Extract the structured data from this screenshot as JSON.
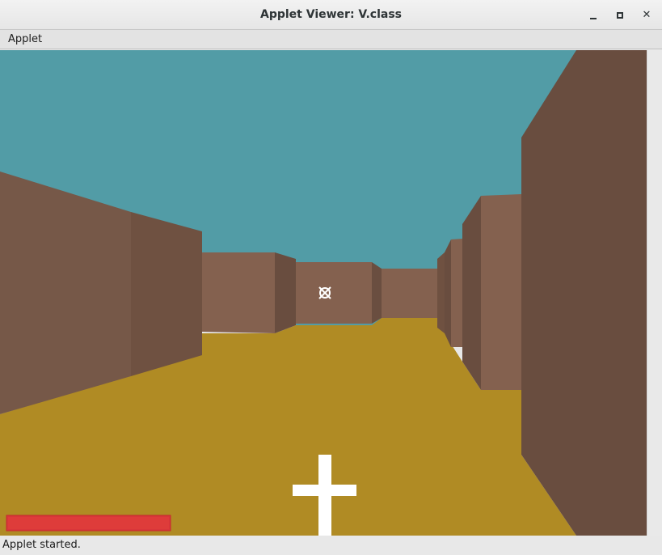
{
  "window": {
    "title": "Applet Viewer: V.class",
    "controls": [
      "minimize-icon",
      "maximize-icon",
      "close-icon"
    ]
  },
  "menu": {
    "items": [
      "Applet"
    ]
  },
  "game": {
    "colors": {
      "sky": "#529ca6",
      "floor": "#b08b24",
      "wall_front": "#83614f",
      "wall_side": "#694d3f",
      "crosshair": "#ffffff",
      "health_bar": "#de3c3a"
    },
    "crosshair_icon": "crosshair-icon",
    "weapon_icon": "cross-weapon-icon",
    "health": 1.0
  },
  "status": {
    "text": "Applet started."
  }
}
